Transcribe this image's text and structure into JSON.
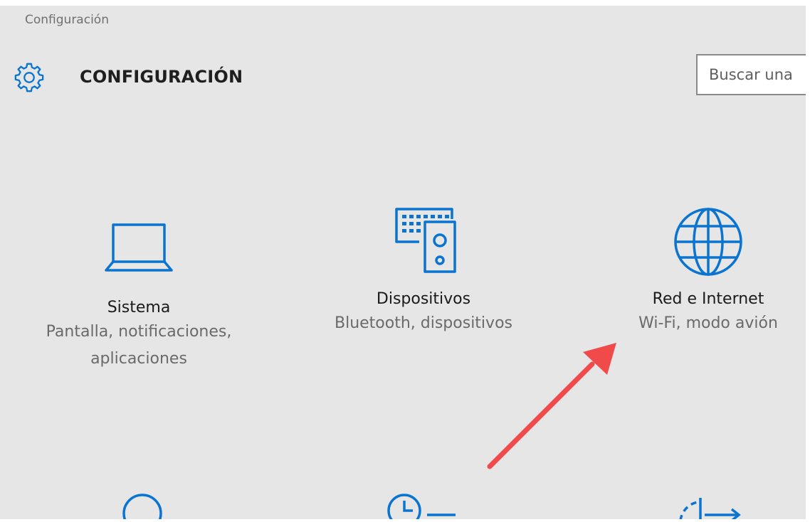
{
  "window": {
    "title": "Configuración"
  },
  "header": {
    "heading": "CONFIGURACIÓN",
    "gear_icon": "gear-icon",
    "search_placeholder": "Buscar una"
  },
  "tiles": [
    {
      "title": "Sistema",
      "subtitle_lines": [
        "Pantalla, notificaciones,",
        "aplicaciones"
      ],
      "icon": "laptop-icon"
    },
    {
      "title": "Dispositivos",
      "subtitle_lines": [
        "Bluetooth, dispositivos"
      ],
      "icon": "devices-icon"
    },
    {
      "title": "Red e Internet",
      "subtitle_lines": [
        "Wi-Fi, modo avión"
      ],
      "icon": "globe-icon"
    }
  ],
  "bottom_row_icons": [
    "personalization-icon",
    "time-language-icon",
    "update-icon"
  ],
  "annotation": {
    "type": "arrow",
    "color": "#f04a4a",
    "points_to": "Red e Internet"
  },
  "colors": {
    "accent": "#0a74d0",
    "background": "#e6e6e6",
    "annotation": "#f04a4a"
  }
}
